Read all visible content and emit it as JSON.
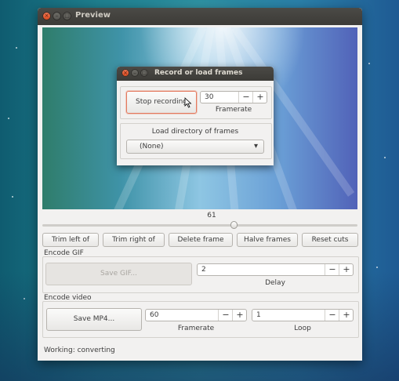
{
  "window": {
    "title": "Preview"
  },
  "dialog": {
    "title": "Record or load frames",
    "stop_recording": "Stop recording",
    "framerate_value": "30",
    "framerate_label": "Framerate",
    "load_dir_label": "Load directory of frames",
    "directory_select": "(None)"
  },
  "slider": {
    "value": "61"
  },
  "edit_buttons": {
    "trim_left": "Trim left of",
    "trim_right": "Trim right of",
    "delete_frame": "Delete frame",
    "halve_frames": "Halve frames",
    "reset_cuts": "Reset cuts"
  },
  "encode_gif": {
    "section": "Encode GIF",
    "save_button": "Save GIF...",
    "delay_value": "2",
    "delay_label": "Delay"
  },
  "encode_video": {
    "section": "Encode video",
    "save_button": "Save MP4...",
    "framerate_value": "60",
    "framerate_label": "Framerate",
    "loop_value": "1",
    "loop_label": "Loop"
  },
  "status": {
    "text": "Working: converting"
  },
  "spinner": {
    "minus": "−",
    "plus": "+"
  },
  "window_controls": {
    "close": "×",
    "minimize": "–",
    "maximize": "□"
  },
  "icons": {
    "combo_arrow": "▾"
  },
  "colors": {
    "accent": "#e47a5f",
    "titlebar": "#3c3b37",
    "window_bg": "#f2f1f0"
  }
}
